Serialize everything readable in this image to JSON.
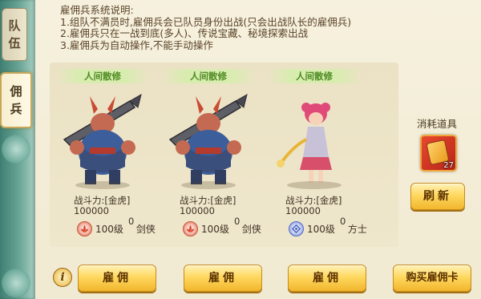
{
  "tabs": {
    "team": {
      "char1": "队",
      "char2": "伍"
    },
    "mercenary": {
      "char1": "佣",
      "char2": "兵"
    }
  },
  "description": {
    "title": "雇佣兵系统说明:",
    "line1": "1.组队不满员时,雇佣兵会已队员身份出战(只会出战队长的雇佣兵)",
    "line2": "2.雇佣兵只在一战到底(多人)、传说宝藏、秘境探索出战",
    "line3": "3.雇佣兵为自动操作,不能手动操作"
  },
  "mercenaries": [
    {
      "source": "人间散修",
      "power_line1": "战斗力:[金虎] 100000",
      "power_line2": "0",
      "level": "100级",
      "class": "剑侠",
      "sect_color": "#d35a3b"
    },
    {
      "source": "人间散修",
      "power_line1": "战斗力:[金虎] 100000",
      "power_line2": "0",
      "level": "100级",
      "class": "剑侠",
      "sect_color": "#d35a3b"
    },
    {
      "source": "人间散修",
      "power_line1": "战斗力:[金虎] 100000",
      "power_line2": "0",
      "level": "100级",
      "class": "方士",
      "sect_color": "#5a6ec7"
    }
  ],
  "consumables": {
    "label": "消耗道具",
    "item_icon": "hire-card-icon",
    "item_count": "27"
  },
  "buttons": {
    "refresh": "刷新",
    "hire": "雇佣",
    "buy_card": "购买雇佣卡",
    "info": "i"
  }
}
